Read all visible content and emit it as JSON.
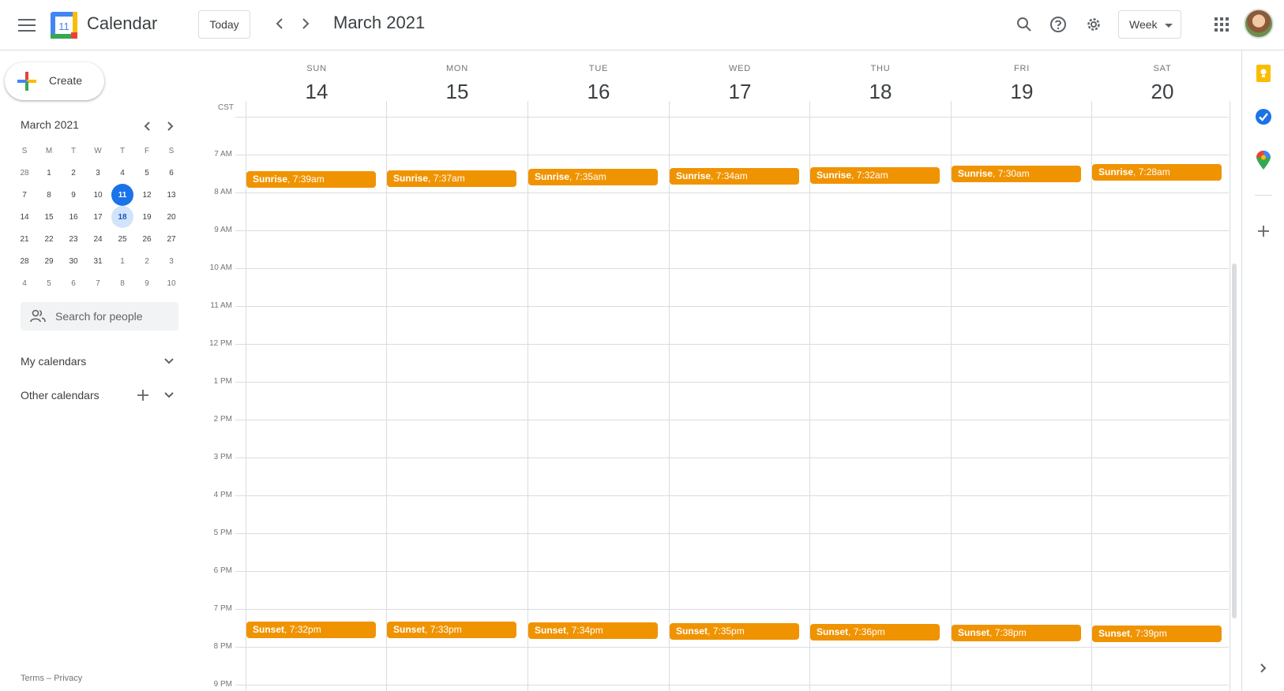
{
  "header": {
    "menu_icon": "hamburger-menu-icon",
    "logo_day": "11",
    "app_title": "Calendar",
    "today_label": "Today",
    "period_title": "March 2021",
    "view_label": "Week"
  },
  "sidebar": {
    "create_label": "Create",
    "mini_calendar": {
      "title": "March 2021",
      "weekdays": [
        "S",
        "M",
        "T",
        "W",
        "T",
        "F",
        "S"
      ],
      "weeks": [
        [
          "28",
          "1",
          "2",
          "3",
          "4",
          "5",
          "6"
        ],
        [
          "7",
          "8",
          "9",
          "10",
          "11",
          "12",
          "13"
        ],
        [
          "14",
          "15",
          "16",
          "17",
          "18",
          "19",
          "20"
        ],
        [
          "21",
          "22",
          "23",
          "24",
          "25",
          "26",
          "27"
        ],
        [
          "28",
          "29",
          "30",
          "31",
          "1",
          "2",
          "3"
        ],
        [
          "4",
          "5",
          "6",
          "7",
          "8",
          "9",
          "10"
        ]
      ],
      "today": "11",
      "selected": "18"
    },
    "search_placeholder": "Search for people",
    "my_calendars": "My calendars",
    "other_calendars": "Other calendars",
    "footer_terms": "Terms",
    "footer_sep": " – ",
    "footer_privacy": "Privacy"
  },
  "grid": {
    "timezone": "CST",
    "days": [
      {
        "dow": "SUN",
        "date": "14"
      },
      {
        "dow": "MON",
        "date": "15"
      },
      {
        "dow": "TUE",
        "date": "16"
      },
      {
        "dow": "WED",
        "date": "17"
      },
      {
        "dow": "THU",
        "date": "18"
      },
      {
        "dow": "FRI",
        "date": "19"
      },
      {
        "dow": "SAT",
        "date": "20"
      }
    ],
    "hours": [
      "7 AM",
      "8 AM",
      "9 AM",
      "10 AM",
      "11 AM",
      "12 PM",
      "1 PM",
      "2 PM",
      "3 PM",
      "4 PM",
      "5 PM",
      "6 PM",
      "7 PM",
      "8 PM",
      "9 PM"
    ],
    "sunrise_label": "Sunrise",
    "sunset_label": "Sunset",
    "sunrise_times": [
      "7:39am",
      "7:37am",
      "7:35am",
      "7:34am",
      "7:32am",
      "7:30am",
      "7:28am"
    ],
    "sunset_times": [
      "7:32pm",
      "7:33pm",
      "7:34pm",
      "7:35pm",
      "7:36pm",
      "7:38pm",
      "7:39pm"
    ],
    "event_color": "#f09300"
  },
  "colors": {
    "accent": "#1a73e8",
    "selected_bg": "#d2e3fc"
  }
}
